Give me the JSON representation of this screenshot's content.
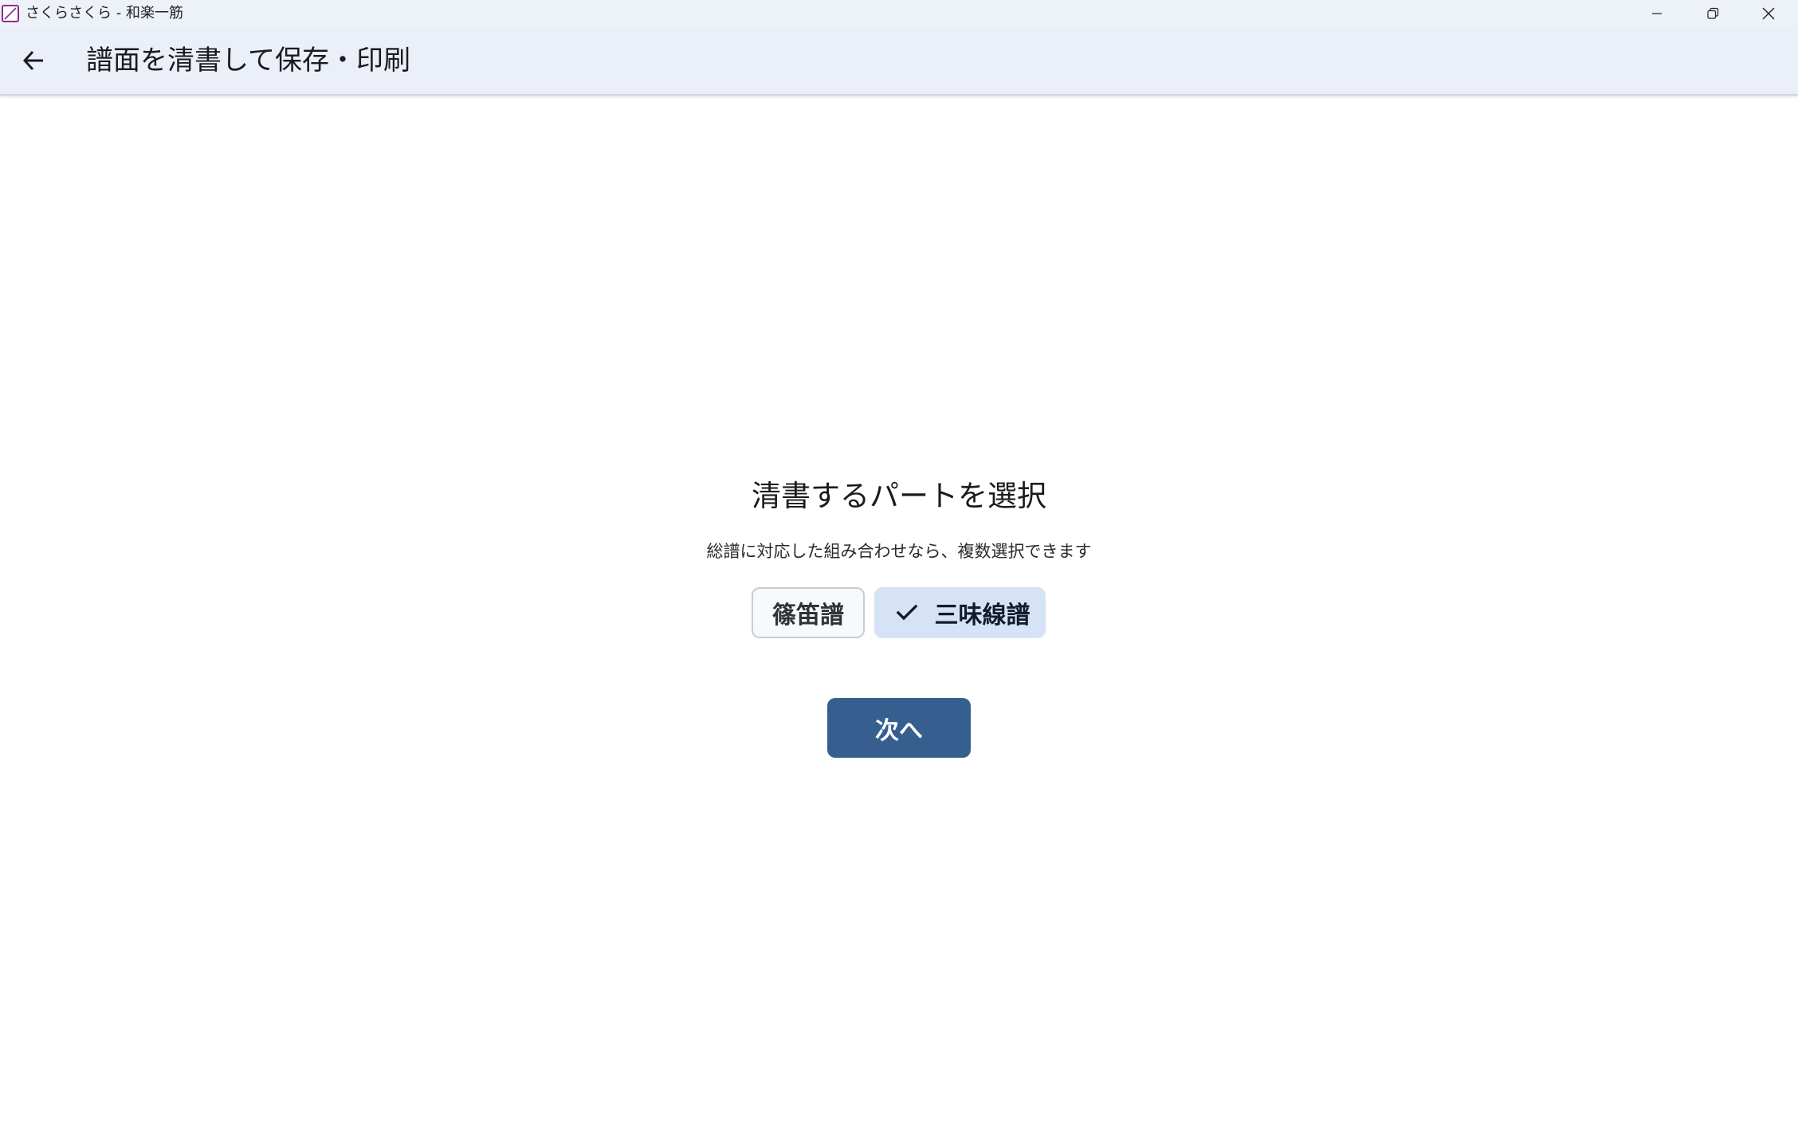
{
  "window": {
    "title": "さくらさくら - 和楽一筋",
    "controls": {
      "minimize_icon": "minimize-icon",
      "maximize_icon": "restore-icon",
      "close_icon": "close-icon"
    }
  },
  "appbar": {
    "back_icon": "arrow-left-icon",
    "title": "譜面を清書して保存・印刷"
  },
  "main": {
    "heading": "清書するパートを選択",
    "description": "総譜に対応した組み合わせなら、複数選択できます",
    "parts": [
      {
        "label": "篠笛譜",
        "selected": false
      },
      {
        "label": "三味線譜",
        "selected": true,
        "icon": "check-icon"
      }
    ],
    "next_button": "次へ"
  },
  "colors": {
    "accent": "#365f8f",
    "selected_chip": "#d6e3f7",
    "appbar_bg": "#ebeff8",
    "titlebar_bg": "#edf1f8"
  }
}
